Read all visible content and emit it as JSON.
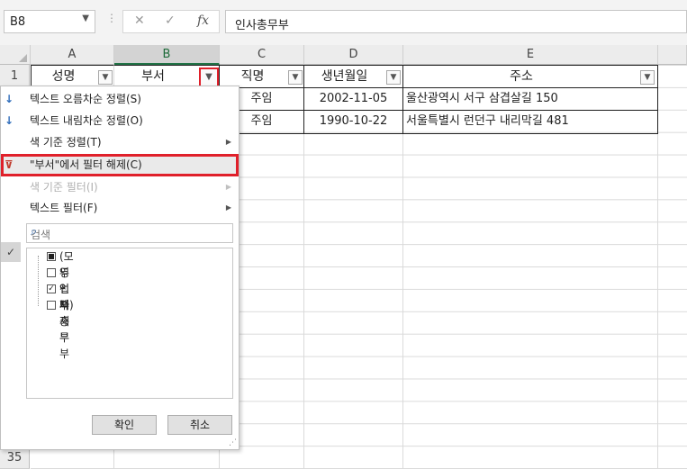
{
  "formula_bar": {
    "name_box": "B8",
    "cancel_icon": "✕",
    "enter_icon": "✓",
    "function_icon": "fx",
    "content": "인사총무부"
  },
  "columns": [
    "A",
    "B",
    "C",
    "D",
    "E"
  ],
  "rows": [
    "1",
    "35"
  ],
  "table": {
    "headers": [
      "성명",
      "부서",
      "직명",
      "생년월일",
      "주소"
    ],
    "data_rows": [
      {
        "c": "주임",
        "d": "2002-11-05",
        "e": "울산광역시 서구 삼겹살길 150"
      },
      {
        "c": "주임",
        "d": "1990-10-22",
        "e": "서울특별시 런던구 내리막길 481"
      }
    ]
  },
  "filter_menu": {
    "sort_asc": "텍스트 오름차순 정렬(S)",
    "sort_desc": "텍스트 내림차순 정렬(O)",
    "sort_by_color": "색 기준 정렬(T)",
    "clear_filter": "\"부서\"에서 필터 해제(C)",
    "filter_by_color": "색 기준 필터(I)",
    "text_filter": "텍스트 필터(F)",
    "search_placeholder": "검색",
    "items": [
      {
        "label": "(모두 선택)",
        "state": "partial"
      },
      {
        "label": "영업부",
        "state": "unchecked"
      },
      {
        "label": "인사총무부",
        "state": "checked"
      },
      {
        "label": "자재부",
        "state": "unchecked"
      }
    ],
    "ok_label": "확인",
    "cancel_label": "취소"
  },
  "colors": {
    "highlight": "#e0202a",
    "accent": "#217346"
  }
}
